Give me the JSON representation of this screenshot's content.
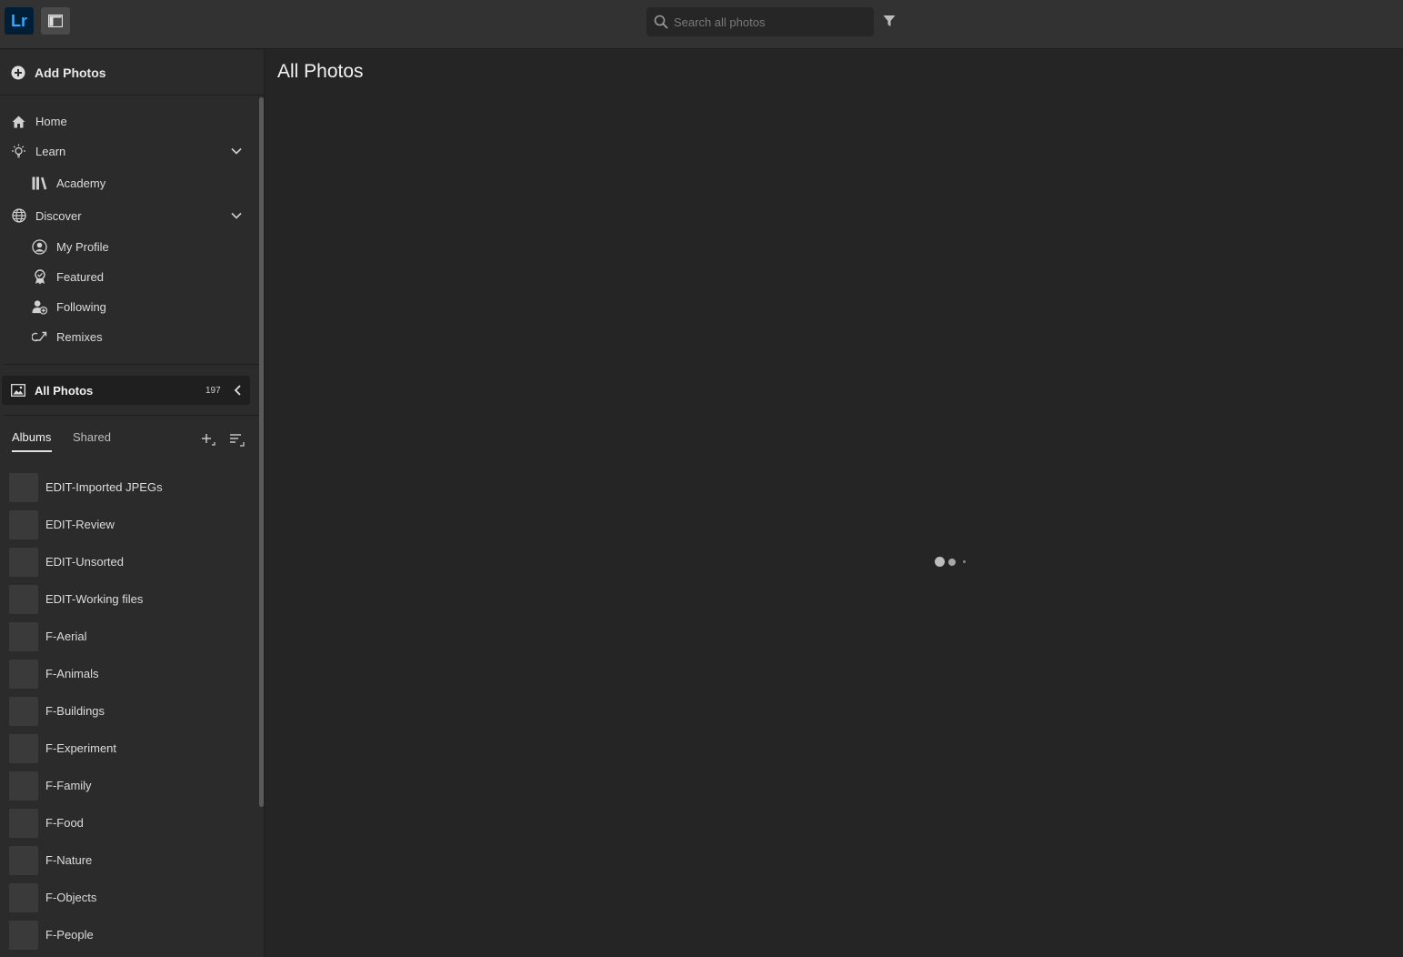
{
  "app": {
    "logo_text": "Lr"
  },
  "search": {
    "placeholder": "Search all photos"
  },
  "sidebar": {
    "add_photos_label": "Add Photos",
    "nav": {
      "home": "Home",
      "learn": "Learn",
      "academy": "Academy",
      "discover": "Discover",
      "my_profile": "My Profile",
      "featured": "Featured",
      "following": "Following",
      "remixes": "Remixes"
    },
    "all_photos": {
      "label": "All Photos",
      "count": "197"
    },
    "tabs": {
      "albums": "Albums",
      "shared": "Shared"
    },
    "albums": [
      "EDIT-Imported JPEGs",
      "EDIT-Review",
      "EDIT-Unsorted",
      "EDIT-Working files",
      "F-Aerial",
      "F-Animals",
      "F-Buildings",
      "F-Experiment",
      "F-Family",
      "F-Food",
      "F-Nature",
      "F-Objects",
      "F-People"
    ]
  },
  "main": {
    "title": "All Photos"
  },
  "colors": {
    "accent": "#31a8ff",
    "logo_bg": "#001e36",
    "background": "#252525",
    "sidebar": "#2b2b2b"
  }
}
